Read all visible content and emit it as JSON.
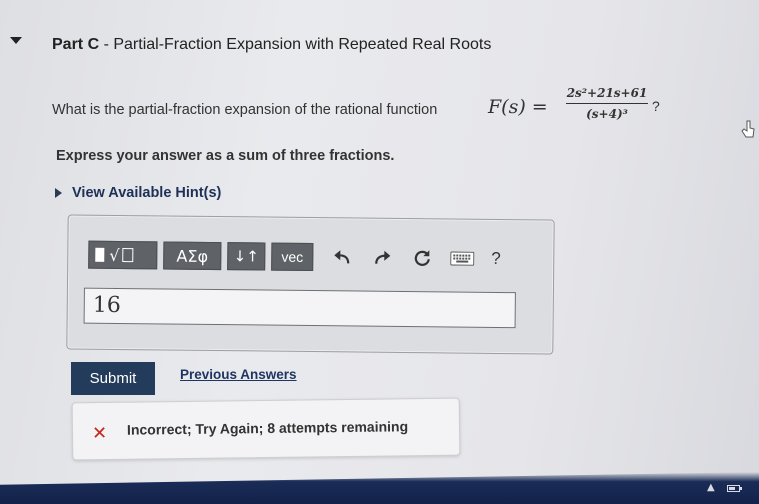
{
  "part": {
    "label": "Part C",
    "separator": " - ",
    "title": "Partial-Fraction Expansion with Repeated Real Roots"
  },
  "question": {
    "text": "What is the partial-fraction expansion of the rational function",
    "function_lhs": "F(s) =",
    "numerator": "2s²+21s+61",
    "denominator": "(s+4)³",
    "trailing": "?"
  },
  "instruction": "Express your answer as a sum of three fractions.",
  "hint": {
    "label": "View Available Hint(s)"
  },
  "toolbar": {
    "greek_label": "ΑΣφ",
    "arrows_label": "↓↑",
    "vec_label": "vec",
    "help_label": "?",
    "icons": [
      "templates-icon",
      "undo-icon",
      "redo-icon",
      "reset-icon",
      "keyboard-icon"
    ]
  },
  "answer": {
    "value": "16"
  },
  "actions": {
    "submit_label": "Submit",
    "previous_answers_label": "Previous Answers"
  },
  "feedback": {
    "icon": "x-icon",
    "message": "Incorrect; Try Again; 8 attempts remaining"
  },
  "colors": {
    "submit_bg": "#243c5c",
    "link": "#1f3561",
    "error": "#c8281e",
    "toolbar_btn": "#5f6266"
  }
}
